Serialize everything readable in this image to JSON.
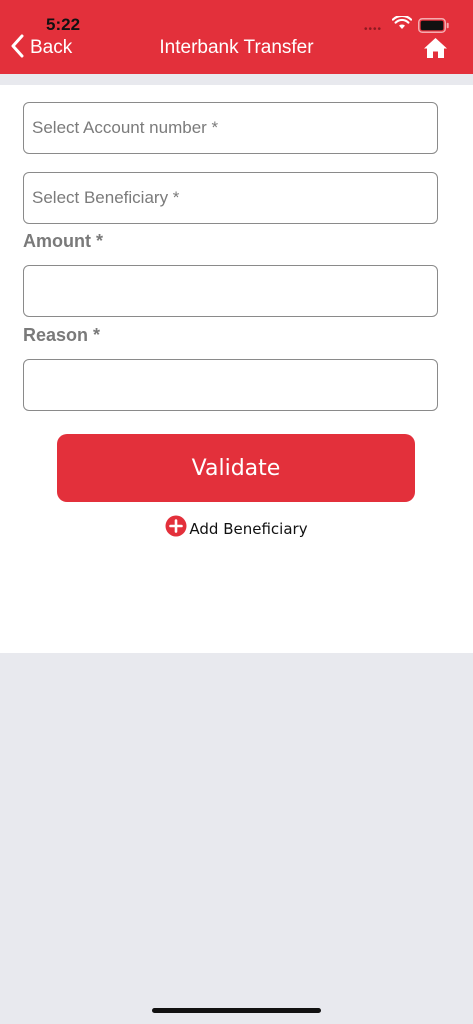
{
  "status_bar": {
    "time": "5:22",
    "signal": "••••",
    "icons": [
      "wifi-icon",
      "battery-icon"
    ]
  },
  "header": {
    "back_label": "Back",
    "title": "Interbank Transfer",
    "back_icon": "chevron-left-icon",
    "home_icon": "home-icon",
    "background": "#e3303b"
  },
  "form": {
    "account_placeholder": "Select Account number *",
    "beneficiary_placeholder": "Select Beneficiary *",
    "amount_label": "Amount *",
    "amount_value": "",
    "reason_label": "Reason *",
    "reason_value": "",
    "validate_label": "Validate",
    "add_beneficiary_label": "Add Beneficiary",
    "add_icon": "plus-circle-icon"
  },
  "colors": {
    "accent": "#e3303b",
    "page_background": "#e8e9ee",
    "label": "#7a7a7a"
  }
}
